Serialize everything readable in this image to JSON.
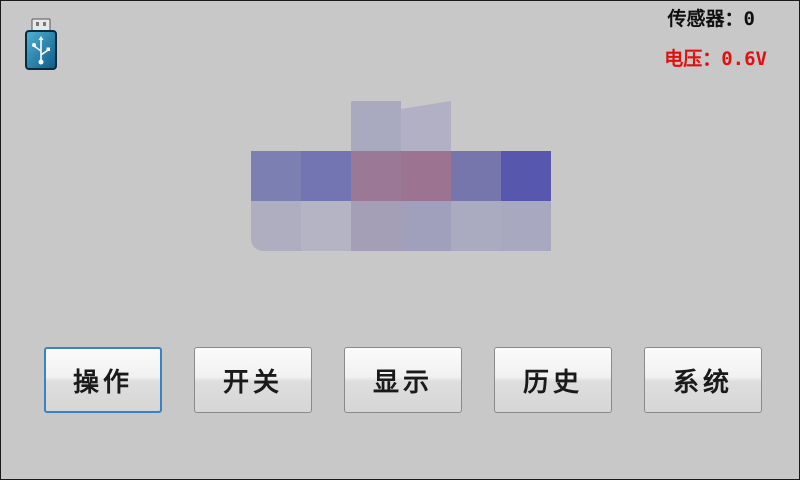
{
  "header": {
    "usb_icon": "usb-drive-icon",
    "sensor": {
      "label": "传感器",
      "separator": "：",
      "value": "0",
      "color": "#101010"
    },
    "voltage": {
      "label": "电压",
      "separator": "：",
      "value": "0.6V",
      "color": "#e01010"
    }
  },
  "logo": {
    "icon": "pixelated-logo"
  },
  "buttons": [
    {
      "label": "操作",
      "active": true
    },
    {
      "label": "开关",
      "active": false
    },
    {
      "label": "显示",
      "active": false
    },
    {
      "label": "历史",
      "active": false
    },
    {
      "label": "系统",
      "active": false
    }
  ],
  "colors": {
    "background": "#c8c8c8",
    "active_border": "#3b82c4",
    "voltage_text": "#e01010"
  }
}
